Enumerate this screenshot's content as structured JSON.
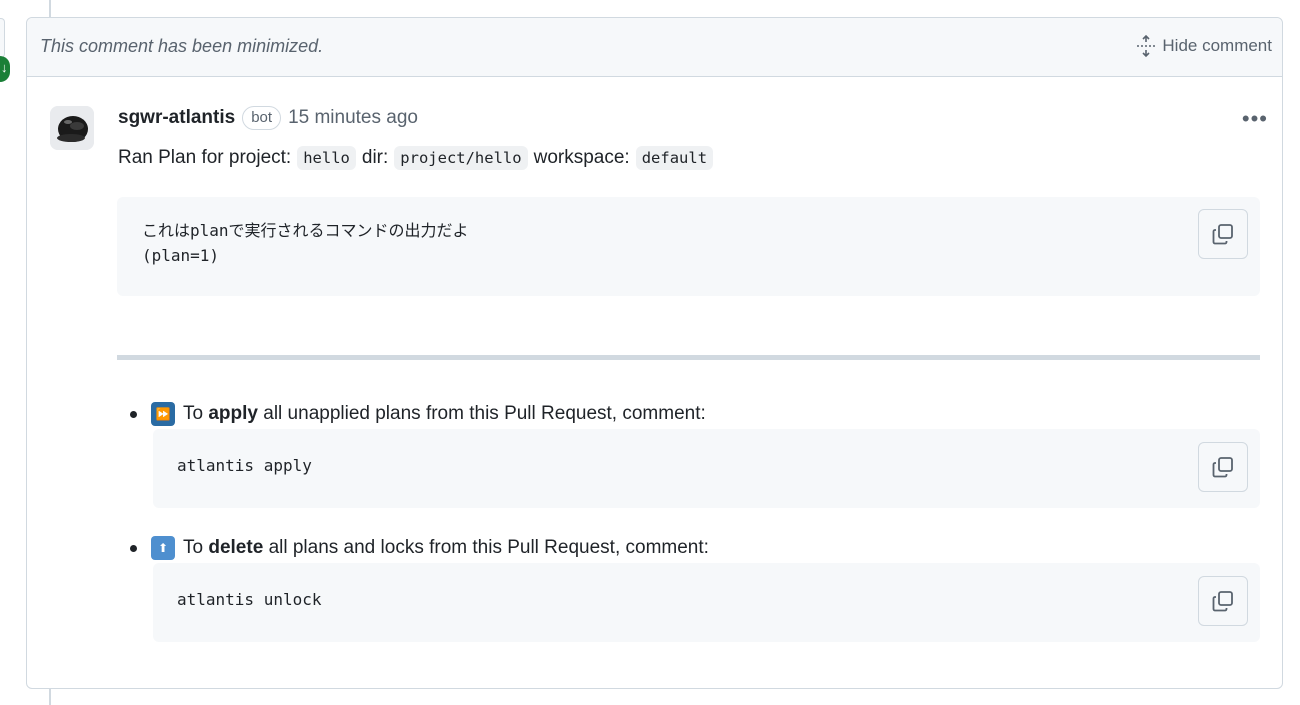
{
  "minimized": {
    "text": "This comment has been minimized.",
    "hide_label": "Hide comment"
  },
  "comment": {
    "author": "sgwr-atlantis",
    "badge": "bot",
    "time": "15 minutes ago",
    "summary": {
      "prefix": "Ran Plan for project:",
      "project": "hello",
      "dir_label": "dir:",
      "dir": "project/hello",
      "workspace_label": "workspace:",
      "workspace": "default"
    },
    "output_line1": "これはplanで実行されるコマンドの出力だよ",
    "output_line2": "(plan=1)"
  },
  "instructions": [
    {
      "prefix": "To",
      "action": "apply",
      "suffix": "all unapplied plans from this Pull Request, comment:",
      "command": "atlantis apply",
      "icon": "fast-forward-icon"
    },
    {
      "prefix": "To",
      "action": "delete",
      "suffix": "all plans and locks from this Pull Request, comment:",
      "command": "atlantis unlock",
      "icon": "up-arrow-icon"
    }
  ],
  "colors": {
    "border": "#d1d9e0",
    "muted": "#59636e",
    "code_bg": "#f6f8fa",
    "accent_green": "#1a7f37"
  }
}
